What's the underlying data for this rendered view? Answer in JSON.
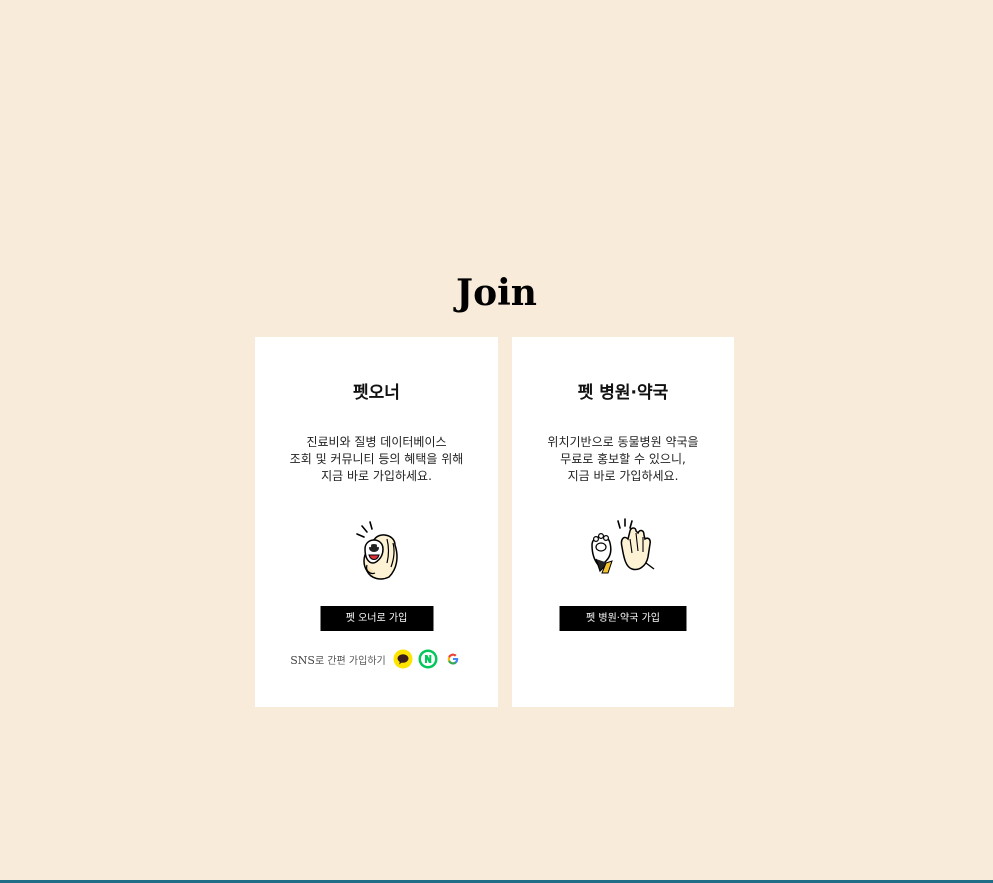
{
  "page": {
    "title": "Join"
  },
  "cards": [
    {
      "title": "펫오너",
      "description": [
        "진료비와 질병 데이터베이스",
        "조회 및 커뮤니티 등의 혜택을 위해",
        "지금 바로 가입하세요."
      ],
      "illustration_icon": "dog-paw-hand-icon",
      "button_label": "펫 오너로 가입",
      "sns": {
        "label_en": "SNS",
        "label_ko": "로 간편 가입하기",
        "icons": [
          "kakao-icon",
          "naver-icon",
          "google-icon"
        ]
      }
    },
    {
      "title": "펫 병원·약국",
      "description": [
        "위치기반으로 동물병원 약국을",
        "무료로 홍보할 수 있으니,",
        "지금 바로 가입하세요."
      ],
      "illustration_icon": "paw-high-five-icon",
      "button_label": "펫 병원·약국 가입"
    }
  ],
  "colors": {
    "background": "#f8ebd9",
    "card": "#ffffff",
    "button": "#000000",
    "kakao": "#fee500",
    "naver": "#03c75a",
    "bottom_bar": "#1f6d86"
  }
}
